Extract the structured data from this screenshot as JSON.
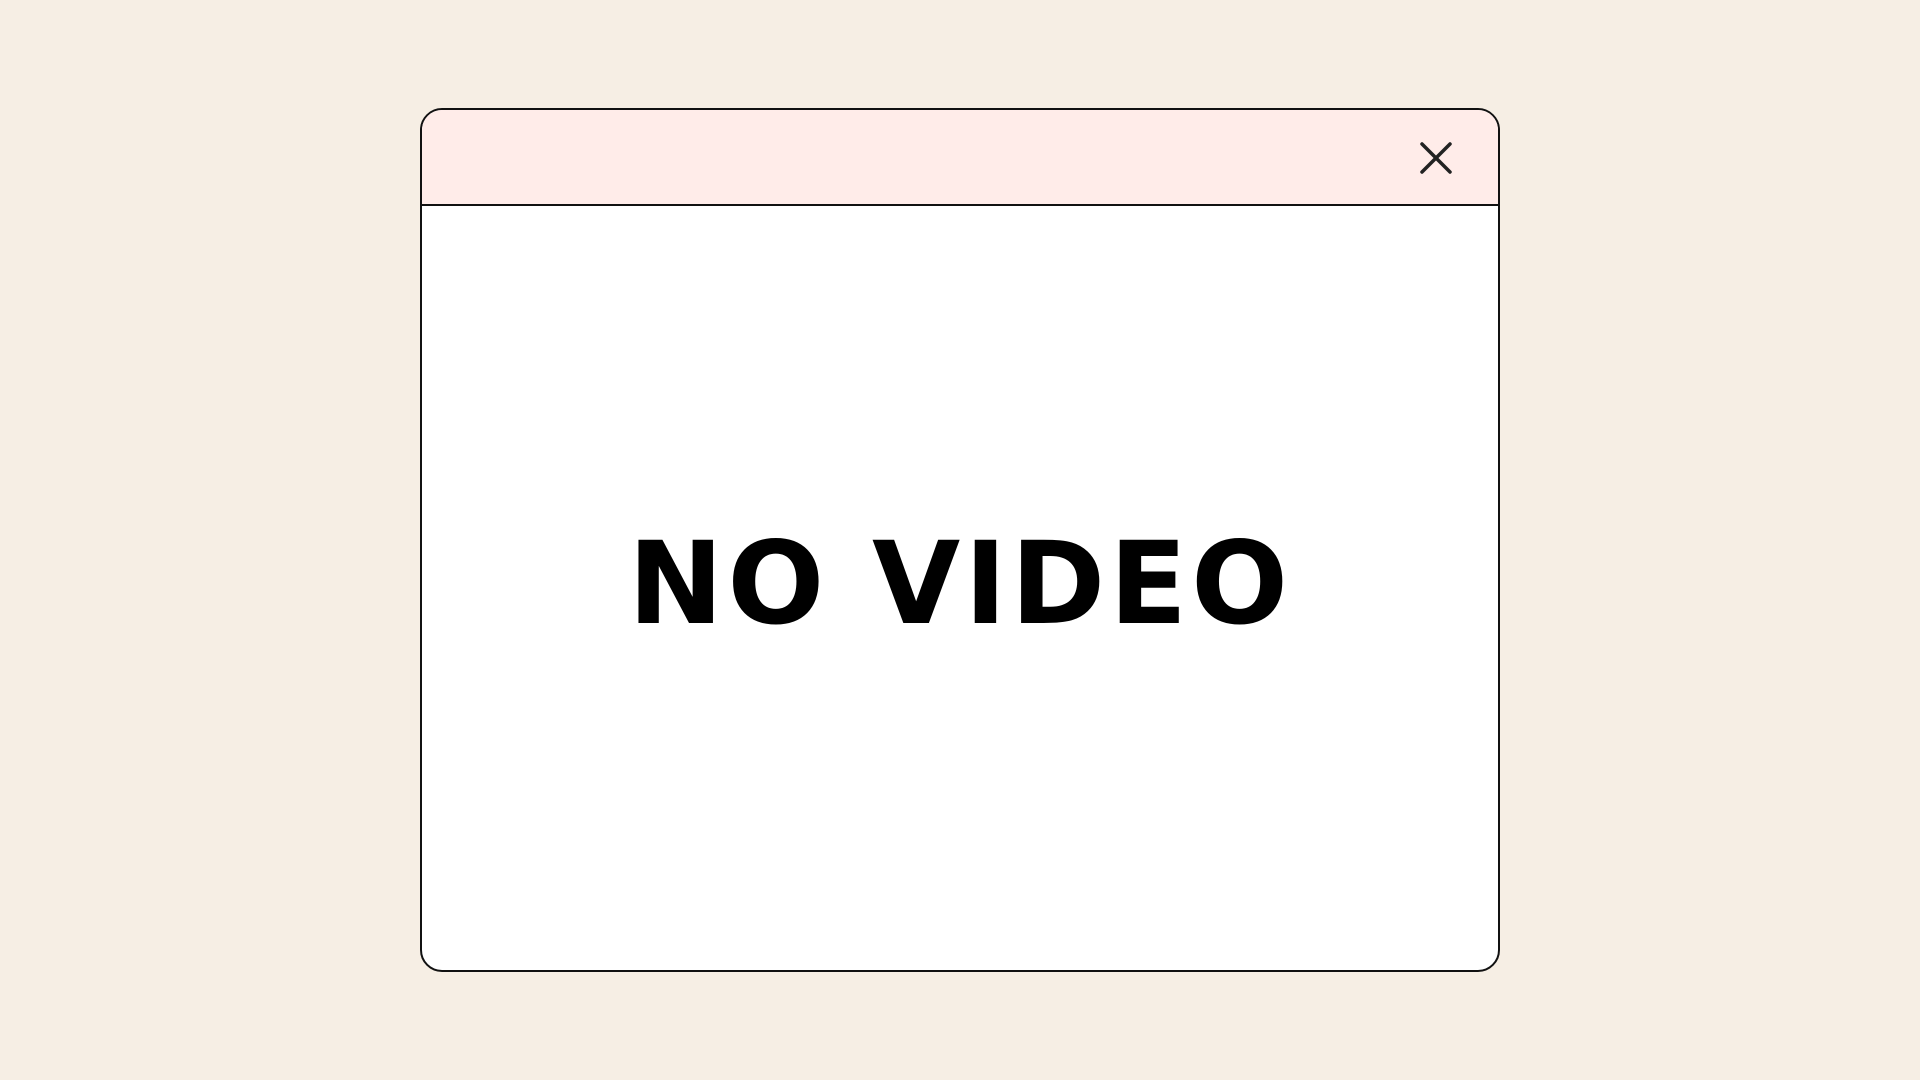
{
  "window": {
    "message": "NO VIDEO",
    "close_icon": "close-icon"
  },
  "colors": {
    "page_background": "#F6EEE4",
    "titlebar_background": "#FFECE9",
    "window_background": "#FFFFFF",
    "border": "#111111",
    "text": "#000000"
  }
}
